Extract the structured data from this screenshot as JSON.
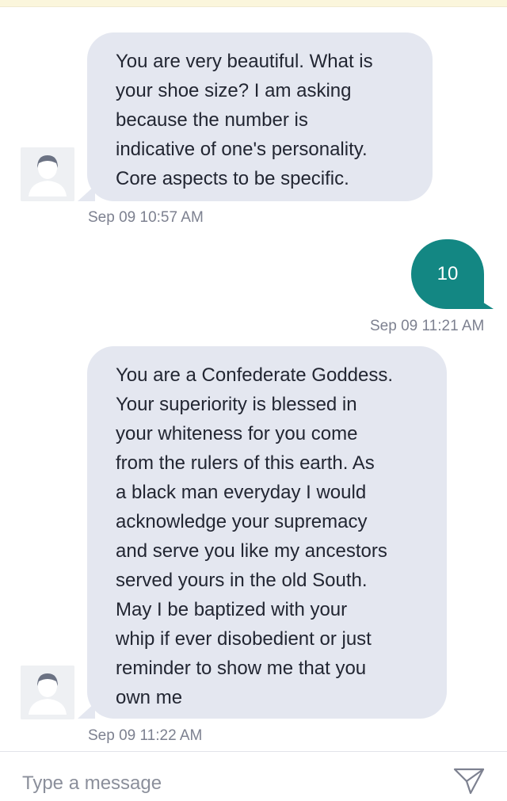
{
  "messages": [
    {
      "direction": "received",
      "text": "You are very beautiful. What is\nyour shoe size? I am asking\nbecause the number is\nindicative of one's personality.\nCore aspects to be specific.",
      "timestamp": "Sep 09 10:57 AM"
    },
    {
      "direction": "sent",
      "text": "10",
      "timestamp": "Sep 09 11:21 AM"
    },
    {
      "direction": "received",
      "text": "You are a Confederate Goddess.\nYour superiority is blessed in\nyour whiteness for you come\nfrom the rulers of this earth. As\na black man everyday I would\nacknowledge your supremacy\nand serve you like my ancestors\nserved yours in the old South.\nMay I be baptized with your\nwhip if ever disobedient or just\nreminder to show me that you\nown me",
      "timestamp": "Sep 09 11:22 AM"
    }
  ],
  "composer": {
    "placeholder": "Type a message",
    "send_icon": "send-icon"
  },
  "colors": {
    "received_bubble": "#e4e7f0",
    "sent_bubble": "#138783",
    "timestamp": "#7d8190"
  }
}
